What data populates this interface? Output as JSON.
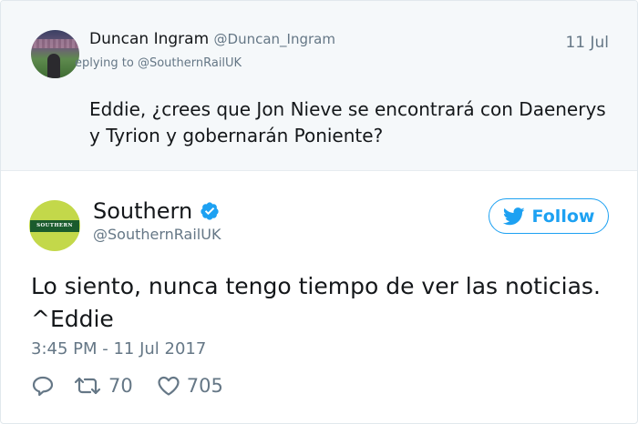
{
  "parent_tweet": {
    "author_name": "Duncan Ingram",
    "author_handle": "@Duncan_Ingram",
    "date": "11 Jul",
    "replying_to": "eplying to @SouthernRailUK",
    "text": "Eddie, ¿crees que Jon Nieve se encontrará con Daenerys y Tyrion y gobernarán Poniente?"
  },
  "main_tweet": {
    "author_name": "Southern",
    "author_handle": "@SouthernRailUK",
    "avatar_logo_text": "SOUTHERN",
    "verified_icon": "verified-badge-icon",
    "follow_label": "Follow",
    "text": "Lo siento, nunca tengo tiempo de ver las noticias. ^Eddie",
    "timestamp": "3:45 PM - 11 Jul 2017",
    "retweet_count": "70",
    "like_count": "705"
  },
  "icons": {
    "reply": "reply-icon",
    "retweet": "retweet-icon",
    "like": "heart-icon",
    "twitter": "twitter-bird-icon"
  },
  "colors": {
    "accent": "#1da1f2",
    "secondary_text": "#657786",
    "parent_background": "#f5f8fa",
    "southern_green": "#1a5b2d",
    "southern_lime": "#c3d84a"
  }
}
